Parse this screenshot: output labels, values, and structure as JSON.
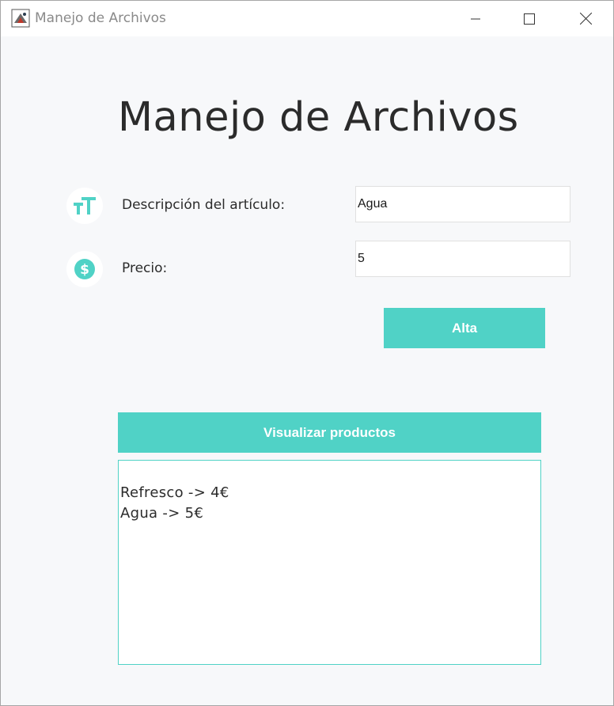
{
  "window": {
    "title": "Manejo de Archivos",
    "app_icon": "java-cup-icon",
    "controls": {
      "minimize_icon": "minimize-icon",
      "maximize_icon": "maximize-icon",
      "close_icon": "close-icon"
    }
  },
  "main": {
    "title": "Manejo de Archivos",
    "form": {
      "description": {
        "icon": "text-size-icon",
        "label": "Descripción del artículo:",
        "value": "Agua"
      },
      "price": {
        "icon": "dollar-coin-icon",
        "label": "Precio:",
        "value": "5"
      },
      "submit_label": "Alta"
    },
    "view_button_label": "Visualizar productos",
    "output_lines": [
      "Refresco -> 4€",
      "Agua -> 5€"
    ]
  },
  "colors": {
    "accent": "#50d2c6",
    "background": "#f7f8fa",
    "text": "#2b2b2b"
  }
}
